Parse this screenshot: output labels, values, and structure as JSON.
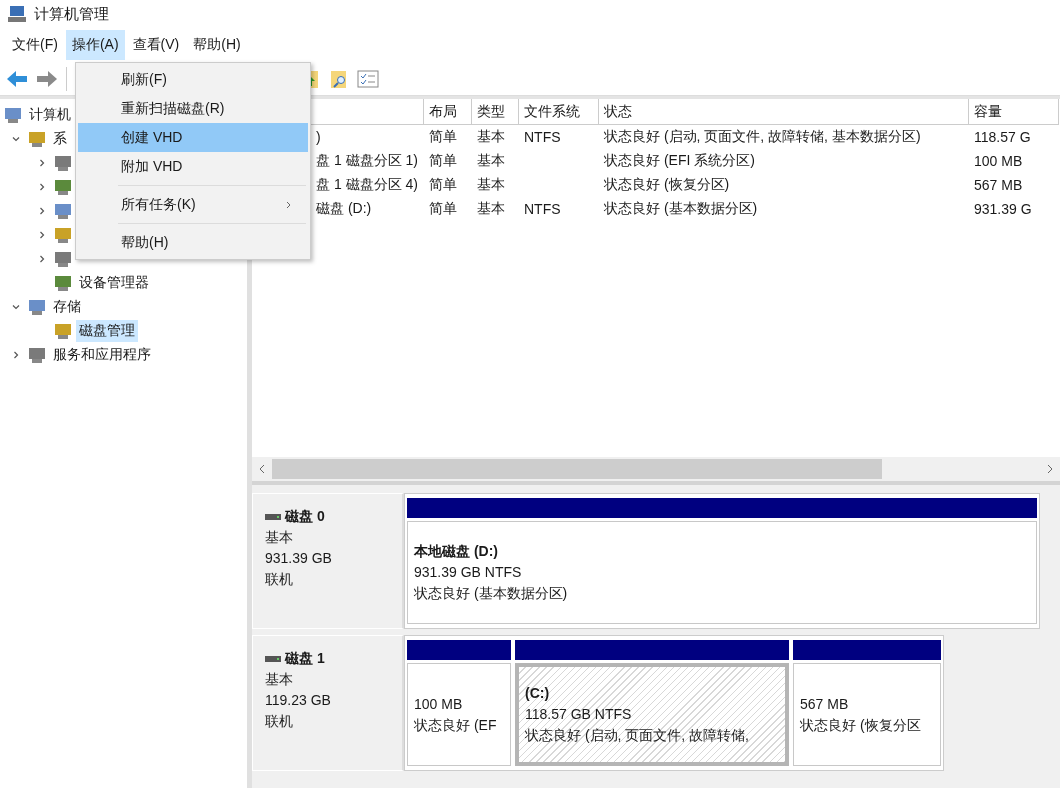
{
  "window": {
    "title": "计算机管理"
  },
  "menubar": [
    {
      "label": "文件(F)",
      "selected": false
    },
    {
      "label": "操作(A)",
      "selected": true
    },
    {
      "label": "查看(V)",
      "selected": false
    },
    {
      "label": "帮助(H)",
      "selected": false
    }
  ],
  "dropdown": {
    "items": [
      {
        "kind": "item",
        "label": "刷新(F)",
        "selected": false,
        "submenu": false
      },
      {
        "kind": "item",
        "label": "重新扫描磁盘(R)",
        "selected": false,
        "submenu": false
      },
      {
        "kind": "item",
        "label": "创建 VHD",
        "selected": true,
        "submenu": false
      },
      {
        "kind": "item",
        "label": "附加 VHD",
        "selected": false,
        "submenu": false
      },
      {
        "kind": "separator"
      },
      {
        "kind": "item",
        "label": "所有任务(K)",
        "selected": false,
        "submenu": true
      },
      {
        "kind": "separator"
      },
      {
        "kind": "item",
        "label": "帮助(H)",
        "selected": false,
        "submenu": false
      }
    ]
  },
  "tree": [
    {
      "label": "计算机",
      "selected": false,
      "children": [
        {
          "label": "系",
          "expanded": true,
          "selected": false,
          "children": [
            {
              "expanded": false
            },
            {
              "expanded": false
            },
            {
              "expanded": false
            },
            {
              "expanded": false
            },
            {
              "expanded": false
            },
            {
              "label": "设备管理器",
              "selected": false
            }
          ]
        },
        {
          "label": "存储",
          "expanded": true,
          "selected": false,
          "children": [
            {
              "label": "磁盘管理",
              "selected": true
            }
          ]
        },
        {
          "label": "服务和应用程序",
          "expanded": false,
          "selected": false
        }
      ]
    }
  ],
  "table": {
    "columns": [
      "",
      "布局",
      "类型",
      "文件系统",
      "状态",
      "容量"
    ],
    "rows": [
      [
        ")",
        "简单",
        "基本",
        "NTFS",
        "状态良好 (启动, 页面文件, 故障转储, 基本数据分区)",
        "118.57 G"
      ],
      [
        "盘 1 磁盘分区 1)",
        "简单",
        "基本",
        "",
        "状态良好 (EFI 系统分区)",
        "100 MB"
      ],
      [
        "盘 1 磁盘分区 4)",
        "简单",
        "基本",
        "",
        "状态良好 (恢复分区)",
        "567 MB"
      ],
      [
        "磁盘 (D:)",
        "简单",
        "基本",
        "NTFS",
        "状态良好 (基本数据分区)",
        "931.39 G"
      ]
    ]
  },
  "disks": [
    {
      "name": "磁盘 0",
      "type": "基本",
      "size": "931.39 GB",
      "status": "联机",
      "partitions": [
        {
          "title": "本地磁盘 (D:)",
          "size": "931.39 GB NTFS",
          "status": "状态良好 (基本数据分区)",
          "selected": false
        }
      ]
    },
    {
      "name": "磁盘 1",
      "type": "基本",
      "size": "119.23 GB",
      "status": "联机",
      "partitions": [
        {
          "size": "100 MB",
          "status": "状态良好 (EF",
          "selected": false
        },
        {
          "title": "(C:)",
          "size": "118.57 GB NTFS",
          "status": "状态良好 (启动, 页面文件, 故障转储,",
          "selected": true
        },
        {
          "size": "567 MB",
          "status": "状态良好 (恢复分区",
          "selected": false
        }
      ]
    }
  ]
}
